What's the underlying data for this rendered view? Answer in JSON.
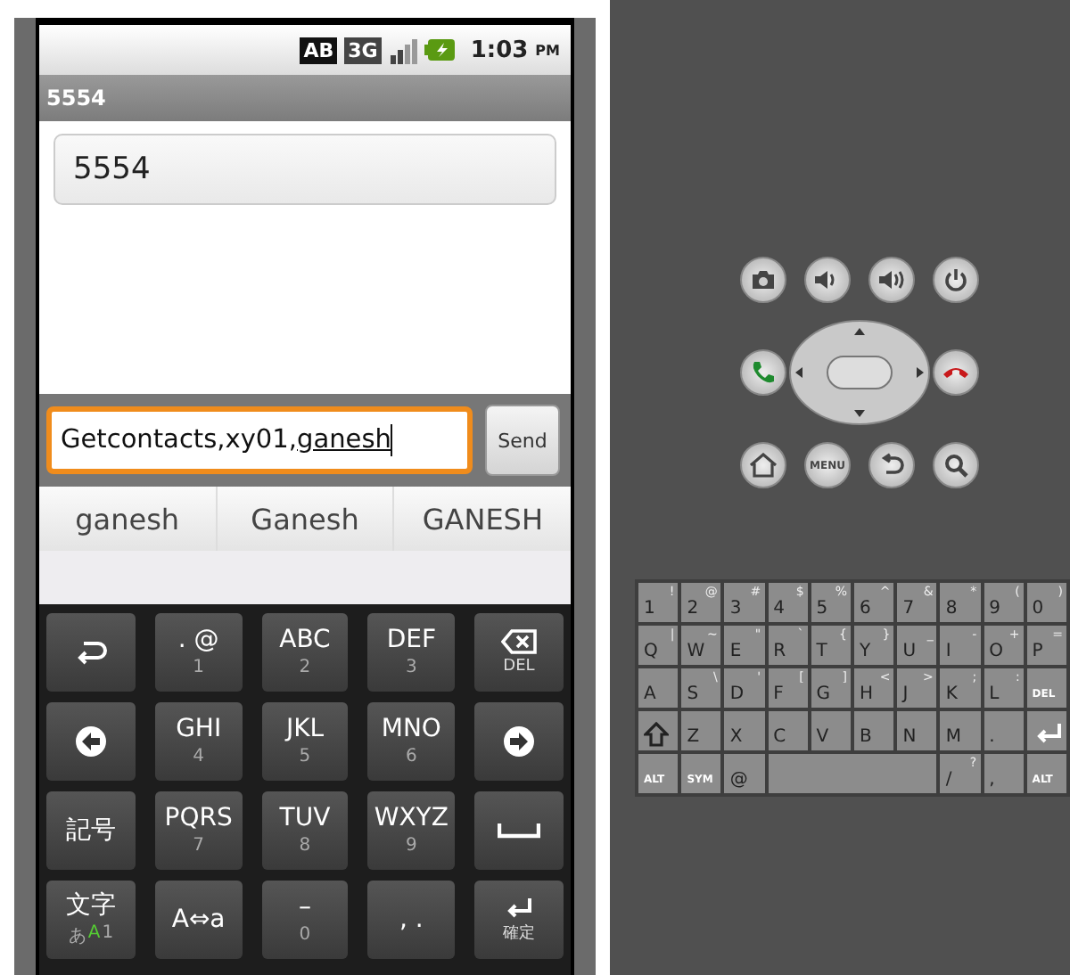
{
  "status_bar": {
    "indicators": [
      "AB",
      "3G"
    ],
    "time": "1:03",
    "ampm": "PM"
  },
  "title_bar": {
    "title": "5554"
  },
  "recipient_field": {
    "value": "5554"
  },
  "compose": {
    "value": "Getcontacts,xy01,",
    "composing": "ganesh",
    "focused": true,
    "send_button": "Send"
  },
  "suggestions": [
    "ganesh",
    "Ganesh",
    "GANESH"
  ],
  "soft_keyboard": {
    "keys": [
      {
        "kind": "icon"
      },
      {
        "kind": "text",
        "label": ". @",
        "sub": "1"
      },
      {
        "kind": "text",
        "label": "ABC",
        "sub": "2"
      },
      {
        "kind": "text",
        "label": "DEF",
        "sub": "3"
      },
      {
        "kind": "icon",
        "sub": "DEL"
      },
      {
        "kind": "icon"
      },
      {
        "kind": "text",
        "label": "GHI",
        "sub": "4"
      },
      {
        "kind": "text",
        "label": "JKL",
        "sub": "5"
      },
      {
        "kind": "text",
        "label": "MNO",
        "sub": "6"
      },
      {
        "kind": "icon"
      },
      {
        "kind": "text",
        "label": "記号"
      },
      {
        "kind": "text",
        "label": "PQRS",
        "sub": "7"
      },
      {
        "kind": "text",
        "label": "TUV",
        "sub": "8"
      },
      {
        "kind": "text",
        "label": "WXYZ",
        "sub": "9"
      },
      {
        "kind": "icon"
      },
      {
        "kind": "mode",
        "label": "文字",
        "modes": [
          {
            "label": "あ",
            "selected": false
          },
          {
            "label": "A",
            "selected": true
          },
          {
            "label": "1",
            "selected": false
          }
        ]
      },
      {
        "kind": "text",
        "label": "A⇔a"
      },
      {
        "kind": "text",
        "label": "–",
        "sub": "0"
      },
      {
        "kind": "text",
        "label": ",  ."
      },
      {
        "kind": "icon",
        "sub": "確定"
      }
    ]
  },
  "emulator_buttons": [
    {
      "kind": "icon"
    },
    {
      "kind": "icon"
    },
    {
      "kind": "icon"
    },
    {
      "kind": "icon"
    },
    {
      "kind": "icon"
    },
    {
      "kind": "dpad"
    },
    {
      "kind": "icon"
    },
    {
      "kind": "icon"
    },
    {
      "kind": "text",
      "label": "MENU"
    },
    {
      "kind": "icon"
    },
    {
      "kind": "icon"
    }
  ],
  "hardware_keyboard": {
    "rows": [
      [
        {
          "kind": "char",
          "main": "1",
          "alt": "!"
        },
        {
          "kind": "char",
          "main": "2",
          "alt": "@"
        },
        {
          "kind": "char",
          "main": "3",
          "alt": "#"
        },
        {
          "kind": "char",
          "main": "4",
          "alt": "$"
        },
        {
          "kind": "char",
          "main": "5",
          "alt": "%"
        },
        {
          "kind": "char",
          "main": "6",
          "alt": "^"
        },
        {
          "kind": "char",
          "main": "7",
          "alt": "&"
        },
        {
          "kind": "char",
          "main": "8",
          "alt": "*"
        },
        {
          "kind": "char",
          "main": "9",
          "alt": "("
        },
        {
          "kind": "char",
          "main": "0",
          "alt": ")"
        }
      ],
      [
        {
          "kind": "char",
          "main": "Q",
          "alt": "|"
        },
        {
          "kind": "char",
          "main": "W",
          "alt": "~"
        },
        {
          "kind": "char",
          "main": "E",
          "alt": "\""
        },
        {
          "kind": "char",
          "main": "R",
          "alt": "`"
        },
        {
          "kind": "char",
          "main": "T",
          "alt": "{"
        },
        {
          "kind": "char",
          "main": "Y",
          "alt": "}"
        },
        {
          "kind": "char",
          "main": "U",
          "alt": "_"
        },
        {
          "kind": "char",
          "main": "I",
          "alt": "-"
        },
        {
          "kind": "char",
          "main": "O",
          "alt": "+"
        },
        {
          "kind": "char",
          "main": "P",
          "alt": "="
        }
      ],
      [
        {
          "kind": "char",
          "main": "A"
        },
        {
          "kind": "char",
          "main": "S",
          "alt": "\\"
        },
        {
          "kind": "char",
          "main": "D",
          "alt": "'"
        },
        {
          "kind": "char",
          "main": "F",
          "alt": "["
        },
        {
          "kind": "char",
          "main": "G",
          "alt": "]"
        },
        {
          "kind": "char",
          "main": "H",
          "alt": "<"
        },
        {
          "kind": "char",
          "main": "J",
          "alt": ">"
        },
        {
          "kind": "char",
          "main": "K",
          "alt": ";"
        },
        {
          "kind": "char",
          "main": "L",
          "alt": ":"
        },
        {
          "kind": "label",
          "main": "DEL"
        }
      ],
      [
        {
          "kind": "icon"
        },
        {
          "kind": "char",
          "main": "Z"
        },
        {
          "kind": "char",
          "main": "X"
        },
        {
          "kind": "char",
          "main": "C"
        },
        {
          "kind": "char",
          "main": "V"
        },
        {
          "kind": "char",
          "main": "B"
        },
        {
          "kind": "char",
          "main": "N"
        },
        {
          "kind": "char",
          "main": "M"
        },
        {
          "kind": "char",
          "main": "."
        },
        {
          "kind": "icon"
        }
      ]
    ],
    "bottom_row": [
      {
        "kind": "label",
        "main": "ALT"
      },
      {
        "kind": "label",
        "main": "SYM"
      },
      {
        "kind": "char",
        "main": "@"
      },
      {
        "kind": "space"
      },
      {
        "kind": "char",
        "main": "/",
        "alt": "?"
      },
      {
        "kind": "char",
        "main": ","
      },
      {
        "kind": "label",
        "main": "ALT"
      }
    ]
  }
}
